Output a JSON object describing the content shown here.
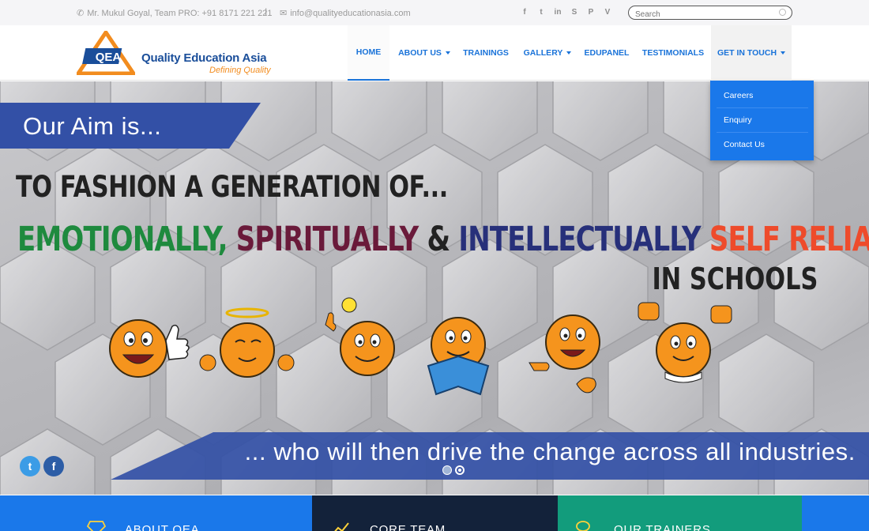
{
  "topbar": {
    "phone": "Mr. Mukul Goyal, Team PRO: +91 8171 221 221",
    "separator": "I",
    "email": "info@qualityeducationasia.com",
    "social_icons": [
      "facebook-icon",
      "twitter-icon",
      "linkedin-icon",
      "skype-icon",
      "pinterest-icon",
      "vimeo-icon"
    ],
    "social_glyphs": [
      "f",
      "t",
      "in",
      "S",
      "P",
      "V"
    ],
    "search_placeholder": "Search"
  },
  "brand": {
    "logo_text": "QEA",
    "name": "Quality Education Asia",
    "tagline": "Defining Quality"
  },
  "nav": {
    "items": [
      {
        "label": "HOME",
        "active": true,
        "caret": false
      },
      {
        "label": "ABOUT US",
        "active": false,
        "caret": true
      },
      {
        "label": "TRAININGS",
        "active": false,
        "caret": false
      },
      {
        "label": "GALLERY",
        "active": false,
        "caret": true
      },
      {
        "label": "EDUPANEL",
        "active": false,
        "caret": false
      },
      {
        "label": "TESTIMONIALS",
        "active": false,
        "caret": false
      },
      {
        "label": "GET IN TOUCH",
        "active": false,
        "caret": true,
        "open": true
      }
    ],
    "dropdown": [
      "Careers",
      "Enquiry",
      "Contact Us"
    ]
  },
  "slide": {
    "aim": "Our Aim is...",
    "line1": "TO FASHION A GENERATION OF...",
    "line2_parts": [
      {
        "text": "EMOTIONALLY, ",
        "color": "#1e8a3e"
      },
      {
        "text": "SPIRITUALLY ",
        "color": "#6a1a3a"
      },
      {
        "text": "& ",
        "color": "#222222"
      },
      {
        "text": "INTELLECTUALLY ",
        "color": "#27307a"
      },
      {
        "text": "SELF RELIANT LEADERS",
        "color": "#ee4b2b"
      }
    ],
    "line3": "IN SCHOOLS",
    "bottom": "... who will then drive the change across all industries.",
    "slide_count": 2,
    "active_slide": 2
  },
  "tiles": [
    {
      "label": "ABOUT QEA",
      "color": "#1a78ea",
      "icon": "diamond-icon"
    },
    {
      "label": "CORE TEAM",
      "color": "#13223a",
      "icon": "chart-icon"
    },
    {
      "label": "OUR TRAINERS",
      "color": "#129c7c",
      "icon": "chat-icon"
    }
  ],
  "colors": {
    "accent": "#1a73d9",
    "banner": "#3350a6",
    "logo_orange": "#f28c1e",
    "logo_blue": "#1a4e9a"
  }
}
